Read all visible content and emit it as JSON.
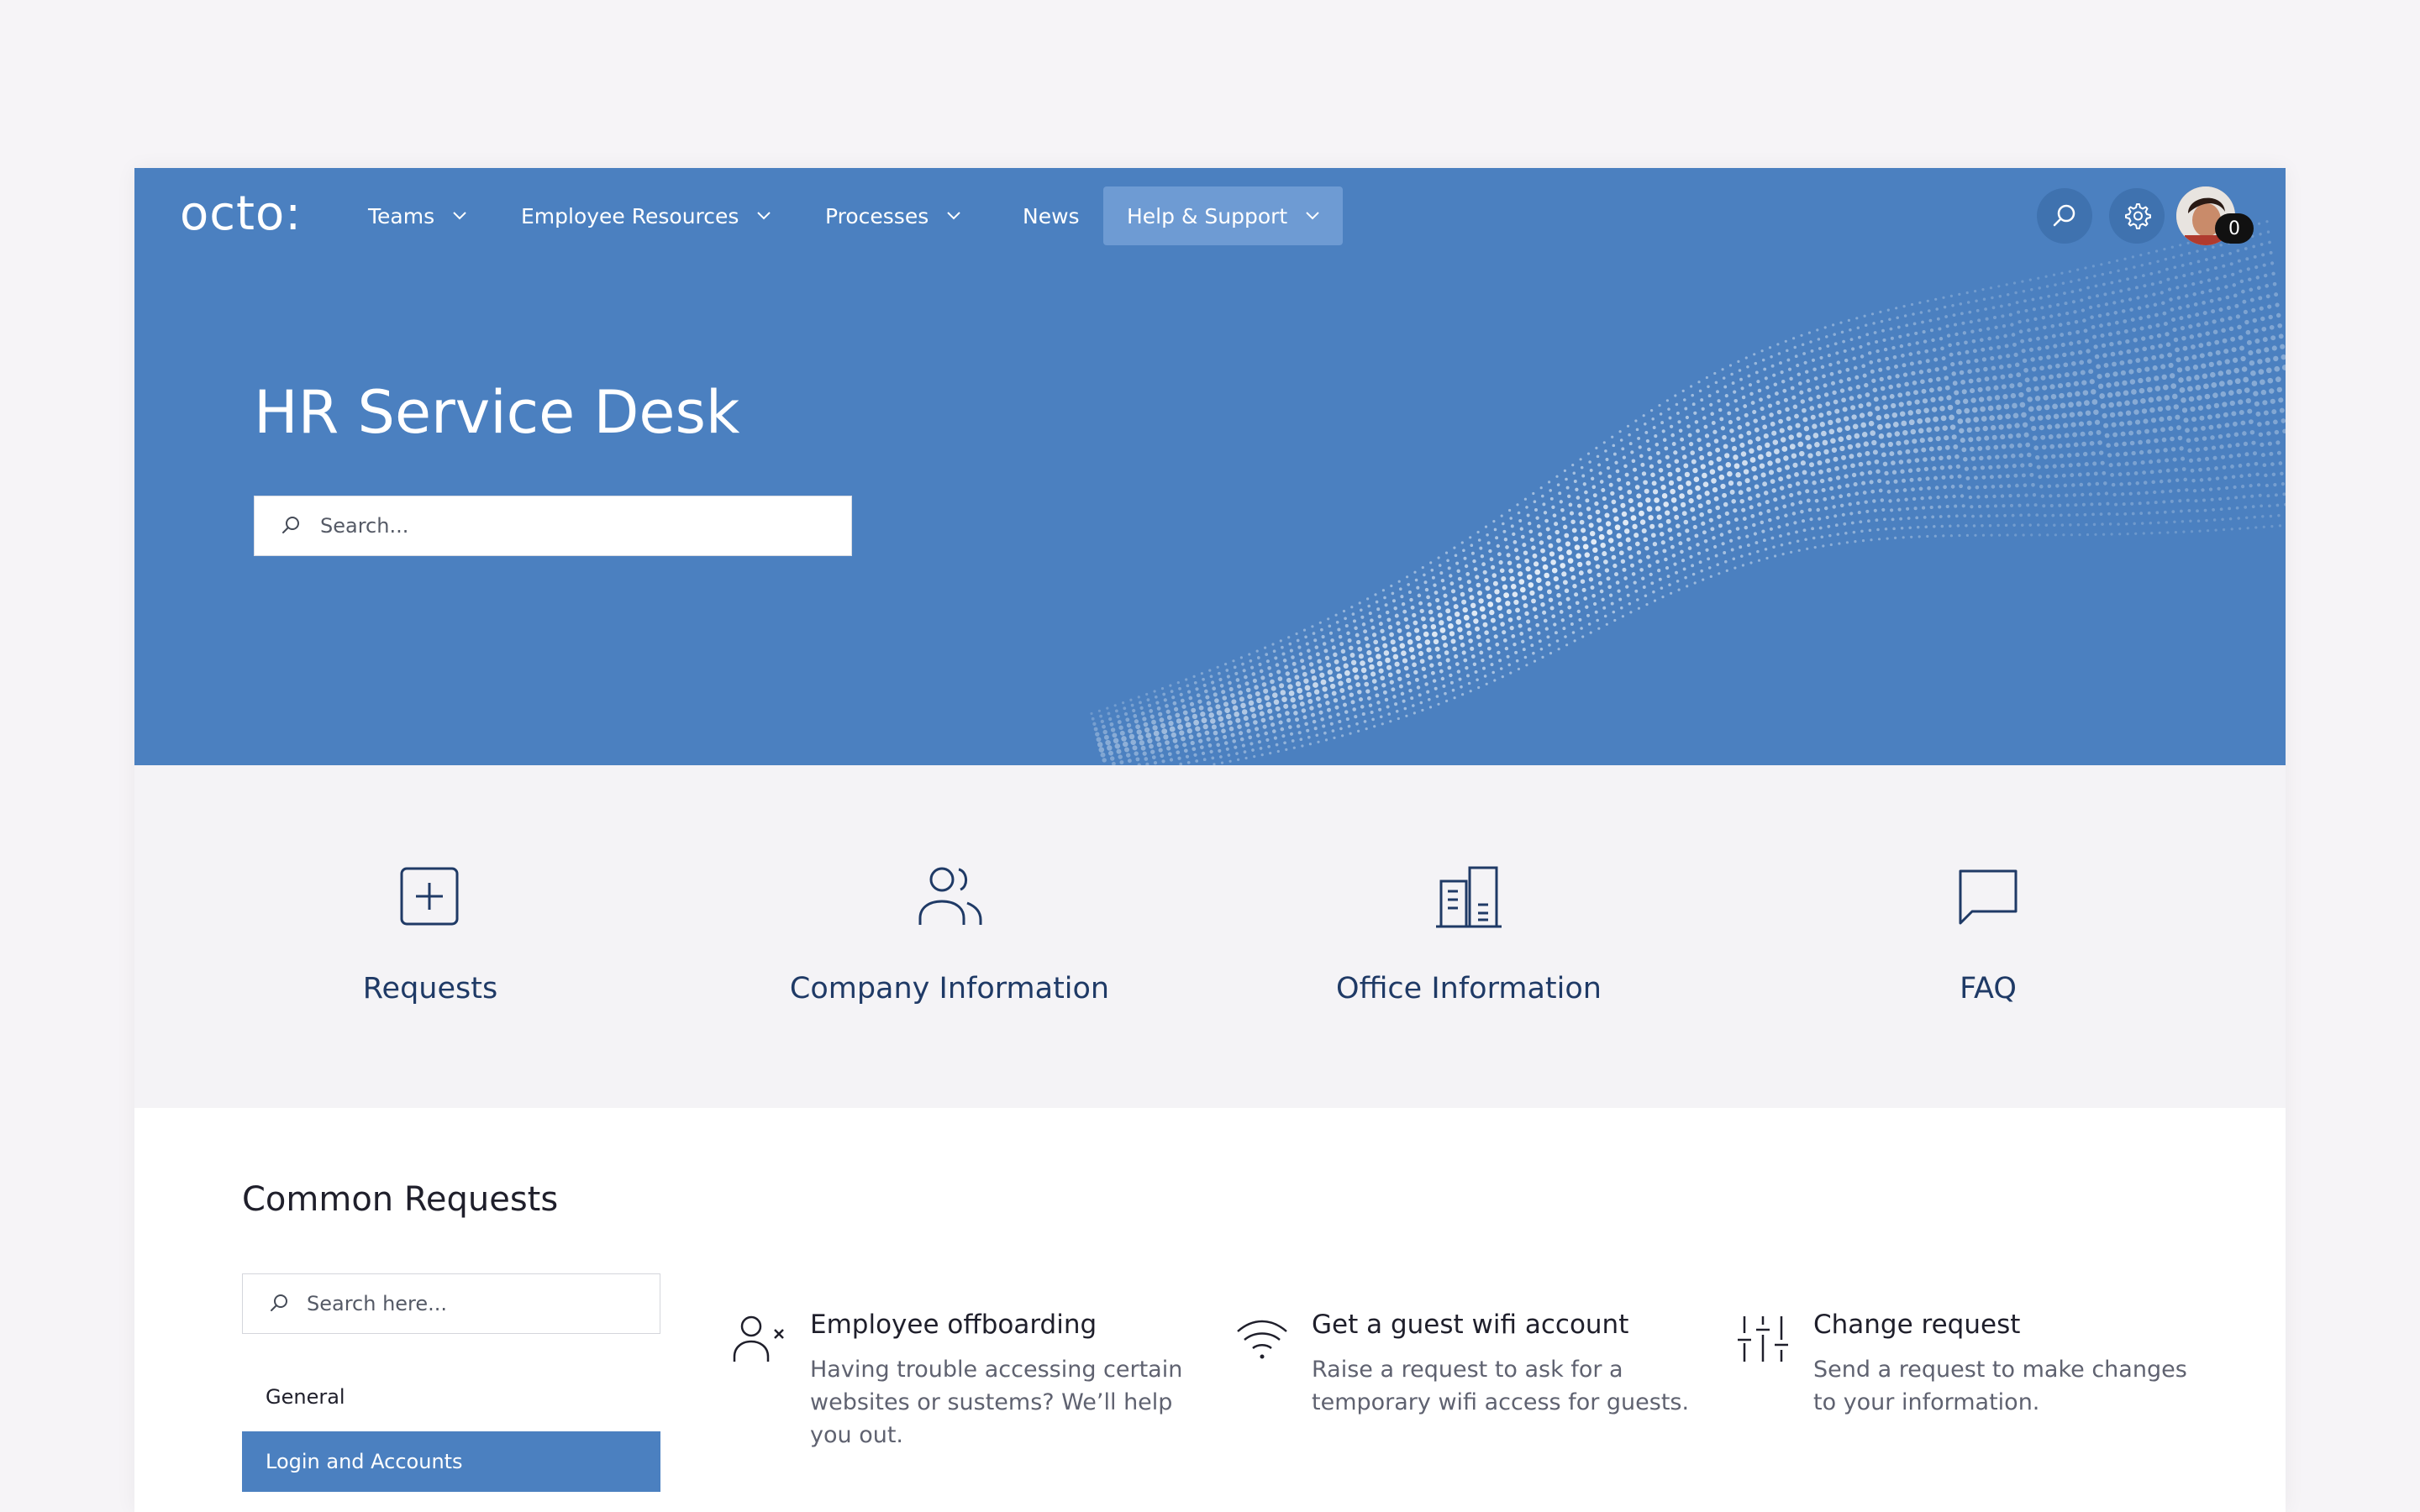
{
  "brand": {
    "logo": "octo:"
  },
  "nav": {
    "items": [
      {
        "label": "Teams",
        "dropdown": true
      },
      {
        "label": "Employee Resources",
        "dropdown": true
      },
      {
        "label": "Processes",
        "dropdown": true
      },
      {
        "label": "News",
        "dropdown": false
      },
      {
        "label": "Help & Support",
        "dropdown": true,
        "active": true
      }
    ],
    "notification_count": "0"
  },
  "hero": {
    "title": "HR Service Desk",
    "search_placeholder": "Search..."
  },
  "categories": [
    {
      "label": "Requests",
      "icon": "plus-square-icon"
    },
    {
      "label": "Company Information",
      "icon": "users-icon"
    },
    {
      "label": "Office Information",
      "icon": "building-icon"
    },
    {
      "label": "FAQ",
      "icon": "chat-bubble-icon"
    }
  ],
  "common_requests": {
    "title": "Common Requests",
    "search_placeholder": "Search here...",
    "sidebar": [
      {
        "label": "General",
        "selected": false
      },
      {
        "label": "Login and Accounts",
        "selected": true
      }
    ],
    "items": [
      {
        "title": "Employee offboarding",
        "description": "Having trouble accessing certain websites or sustems? We’ll help you out.",
        "icon": "user-remove-icon"
      },
      {
        "title": "Get a guest wifi account",
        "description": "Raise a request to ask for a temporary wifi access for guests.",
        "icon": "wifi-icon"
      },
      {
        "title": "Change request",
        "description": "Send a request to make changes to your information.",
        "icon": "sliders-icon"
      }
    ]
  },
  "colors": {
    "primary": "#4b80c0",
    "nav_active": "#6e9bd3",
    "text_dark_blue": "#1f3a66",
    "strip_bg": "#f4f3f6"
  }
}
